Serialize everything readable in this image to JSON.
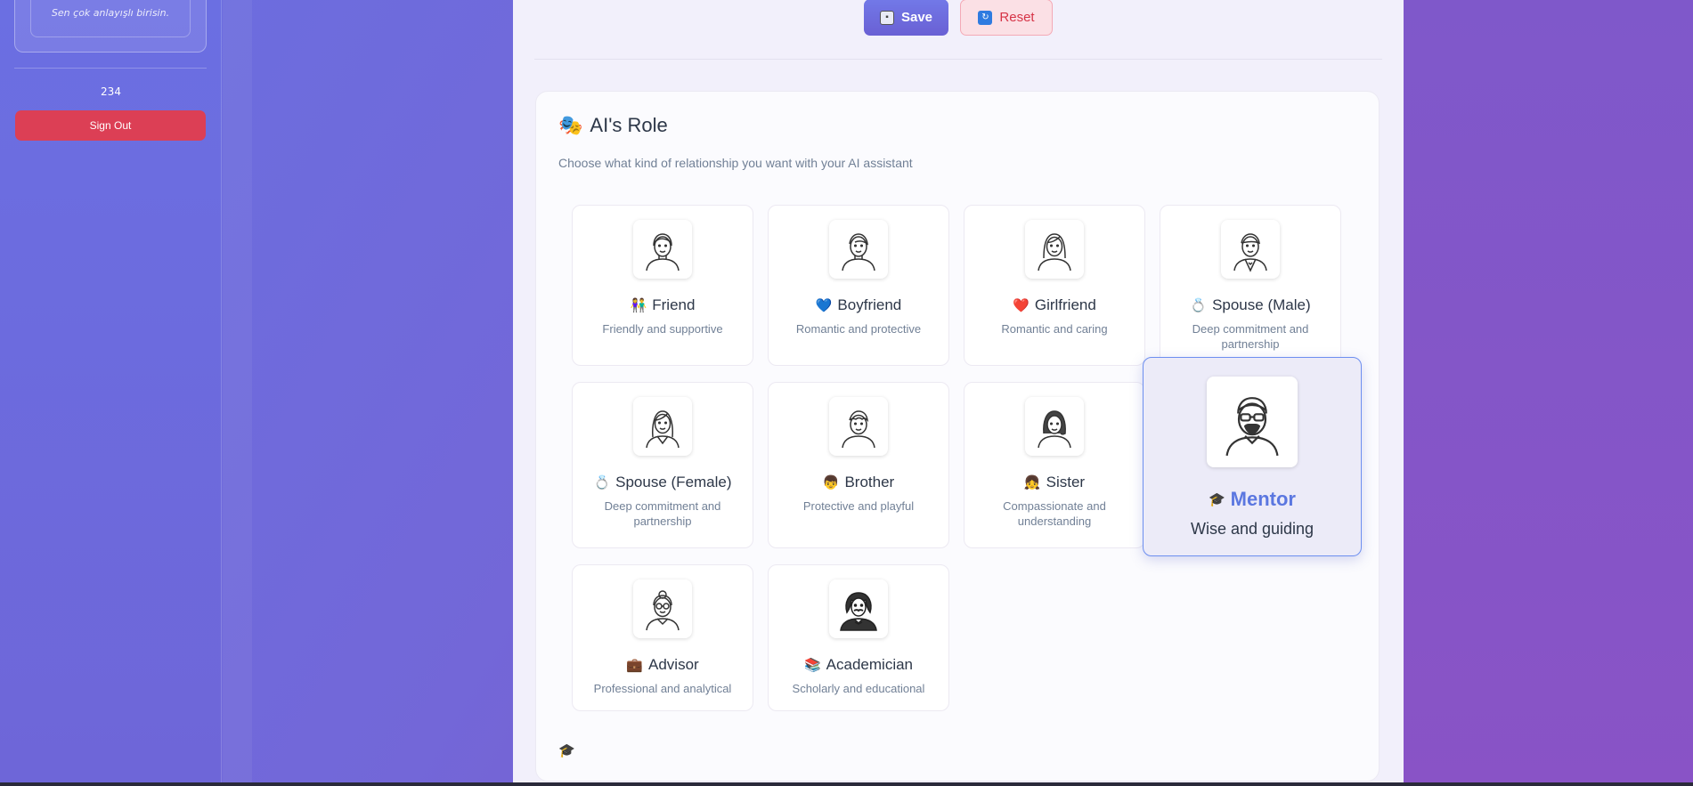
{
  "sidebar": {
    "quote_text": "Sen çok anlayışlı birisin.",
    "count": "234",
    "sign_out_label": "Sign Out"
  },
  "toolbar": {
    "save_label": "Save",
    "reset_label": "Reset"
  },
  "role_section": {
    "title": "AI's Role",
    "title_icon": "🎭",
    "description": "Choose what kind of relationship you want with your AI assistant",
    "selected": "Mentor",
    "options": [
      {
        "emoji": "👫",
        "name": "Friend",
        "desc": "Friendly and supportive"
      },
      {
        "emoji": "💙",
        "name": "Boyfriend",
        "desc": "Romantic and protective"
      },
      {
        "emoji": "❤️",
        "name": "Girlfriend",
        "desc": "Romantic and caring"
      },
      {
        "emoji": "💍",
        "name": "Spouse (Male)",
        "desc": "Deep commitment and partnership"
      },
      {
        "emoji": "💍",
        "name": "Spouse (Female)",
        "desc": "Deep commitment and partnership"
      },
      {
        "emoji": "👦",
        "name": "Brother",
        "desc": "Protective and playful"
      },
      {
        "emoji": "👧",
        "name": "Sister",
        "desc": "Compassionate and understanding"
      },
      {
        "emoji": "🎓",
        "name": "Mentor",
        "desc": "Wise and guiding"
      },
      {
        "emoji": "💼",
        "name": "Advisor",
        "desc": "Professional and analytical"
      },
      {
        "emoji": "📚",
        "name": "Academician",
        "desc": "Scholarly and educational"
      }
    ],
    "footer_icon": "🎓"
  },
  "colors": {
    "accent": "#6a60d4",
    "selected_border": "#6d8ff0",
    "selected_text": "#5b77e0",
    "danger": "#dc3f55"
  }
}
